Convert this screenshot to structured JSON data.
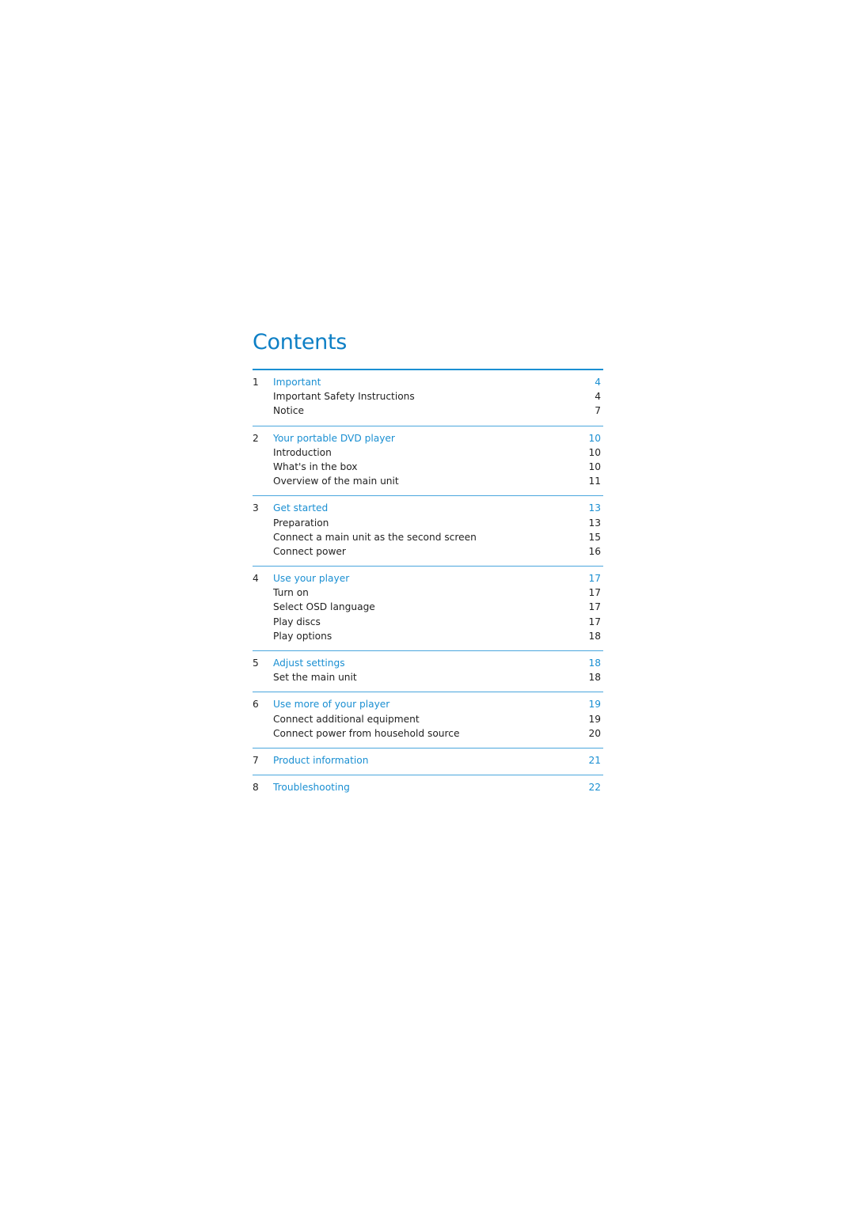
{
  "title": "Contents",
  "colors": {
    "accent": "#1a8fd2",
    "title": "#0d7fc5",
    "text": "#222222"
  },
  "sections": [
    {
      "number": "1",
      "title": "Important",
      "page": "4",
      "items": [
        {
          "title": "Important Safety Instructions",
          "page": "4"
        },
        {
          "title": "Notice",
          "page": "7"
        }
      ]
    },
    {
      "number": "2",
      "title": "Your portable DVD player",
      "page": "10",
      "items": [
        {
          "title": "Introduction",
          "page": "10"
        },
        {
          "title": "What's in the box",
          "page": "10"
        },
        {
          "title": "Overview of the main unit",
          "page": "11"
        }
      ]
    },
    {
      "number": "3",
      "title": "Get started",
      "page": "13",
      "items": [
        {
          "title": "Preparation",
          "page": "13"
        },
        {
          "title": "Connect a main unit as the second screen",
          "page": "15"
        },
        {
          "title": "Connect power",
          "page": "16"
        }
      ]
    },
    {
      "number": "4",
      "title": "Use your player",
      "page": "17",
      "items": [
        {
          "title": "Turn on",
          "page": "17"
        },
        {
          "title": "Select OSD language",
          "page": "17"
        },
        {
          "title": "Play discs",
          "page": "17"
        },
        {
          "title": "Play options",
          "page": "18"
        }
      ]
    },
    {
      "number": "5",
      "title": "Adjust settings",
      "page": "18",
      "items": [
        {
          "title": "Set the main unit",
          "page": "18"
        }
      ]
    },
    {
      "number": "6",
      "title": "Use more of your player",
      "page": "19",
      "items": [
        {
          "title": "Connect additional equipment",
          "page": "19"
        },
        {
          "title": "Connect power from household source",
          "page": "20"
        }
      ]
    },
    {
      "number": "7",
      "title": "Product information",
      "page": "21",
      "items": []
    },
    {
      "number": "8",
      "title": "Troubleshooting",
      "page": "22",
      "items": []
    }
  ]
}
